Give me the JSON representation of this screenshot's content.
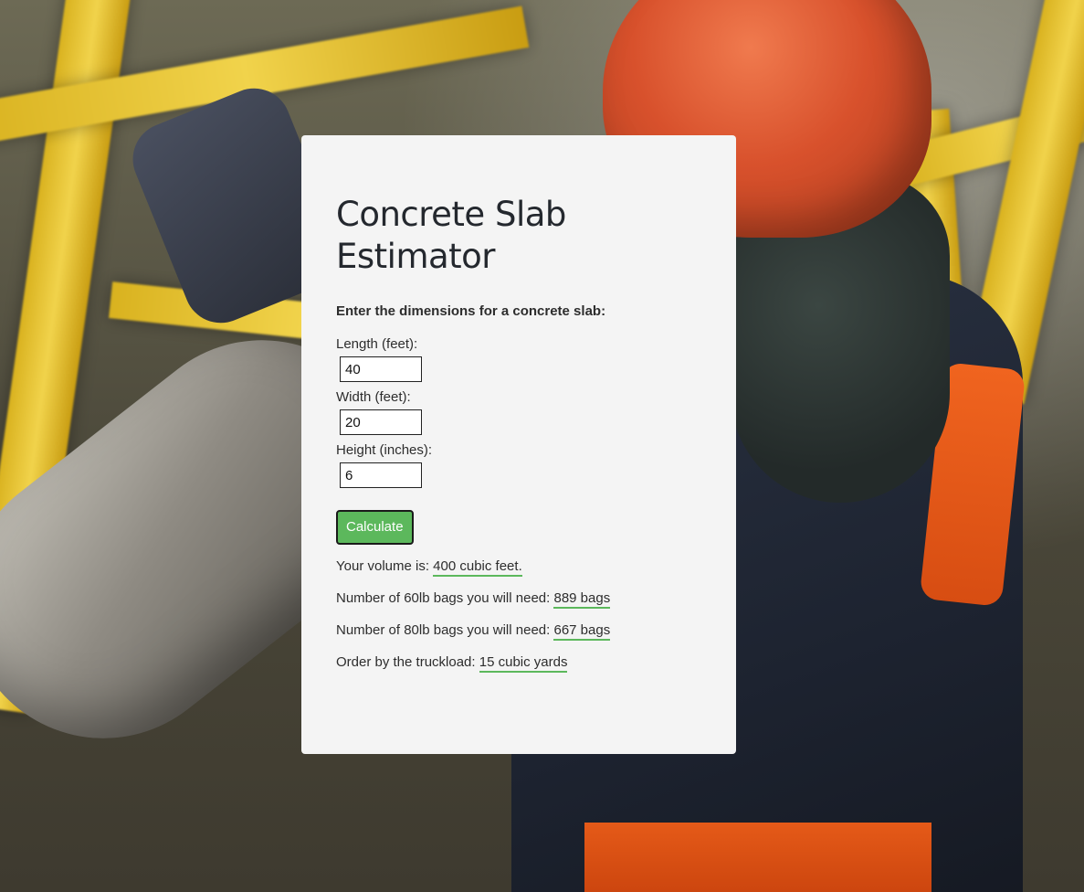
{
  "page": {
    "title": "Concrete Slab Estimator"
  },
  "form": {
    "intro": "Enter the dimensions for a concrete slab:",
    "fields": [
      {
        "label": "Length (feet):",
        "value": "40"
      },
      {
        "label": "Width (feet):",
        "value": "20"
      },
      {
        "label": "Height (inches):",
        "value": "6"
      }
    ],
    "calculate_label": "Calculate"
  },
  "results": {
    "volume": {
      "label": "Your volume is:",
      "value": "400 cubic feet."
    },
    "bags_60": {
      "label": "Number of 60lb bags you will need:",
      "value": "889 bags"
    },
    "bags_80": {
      "label": "Number of 80lb bags you will need:",
      "value": "667 bags"
    },
    "truckload": {
      "label": "Order by the truckload:",
      "value": "15 cubic yards"
    }
  },
  "colors": {
    "accent": "#5cb85c",
    "card_background": "#f4f4f4",
    "title_text": "#24282e"
  }
}
